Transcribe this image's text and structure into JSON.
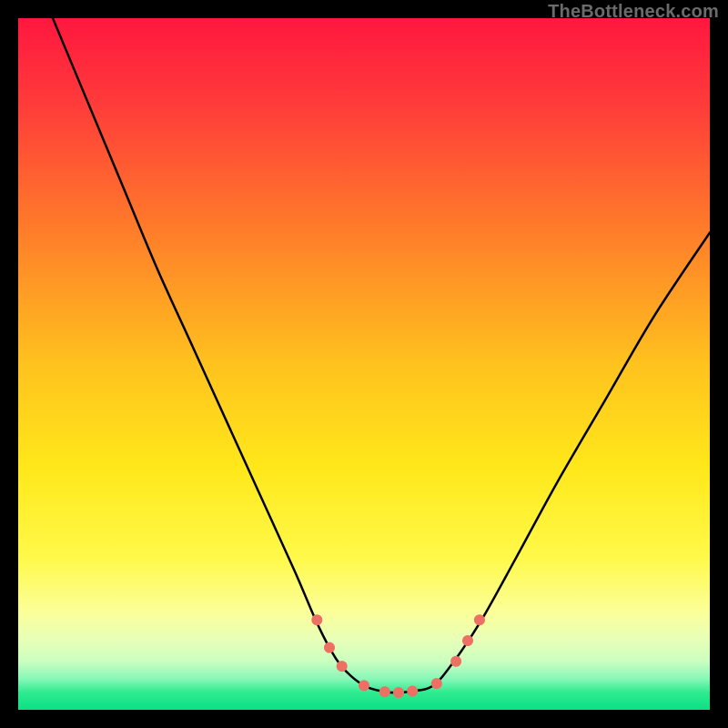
{
  "attribution": "TheBottleneck.com",
  "colors": {
    "frame": "#000000",
    "curve": "#000000",
    "marker_fill": "#ec7063",
    "gradient_stops": [
      {
        "offset": 0.0,
        "color": "#ff173f"
      },
      {
        "offset": 0.12,
        "color": "#ff3a3a"
      },
      {
        "offset": 0.3,
        "color": "#ff7a2a"
      },
      {
        "offset": 0.5,
        "color": "#ffc21e"
      },
      {
        "offset": 0.65,
        "color": "#ffe81a"
      },
      {
        "offset": 0.78,
        "color": "#fff94a"
      },
      {
        "offset": 0.86,
        "color": "#fbff9a"
      },
      {
        "offset": 0.9,
        "color": "#e7ffb8"
      },
      {
        "offset": 0.93,
        "color": "#caffc0"
      },
      {
        "offset": 0.955,
        "color": "#88f7b8"
      },
      {
        "offset": 0.975,
        "color": "#2eeb8f"
      },
      {
        "offset": 1.0,
        "color": "#0ddf85"
      }
    ]
  },
  "chart_data": {
    "type": "line",
    "title": "",
    "xlabel": "",
    "ylabel": "",
    "xlim": [
      0,
      100
    ],
    "ylim": [
      0,
      100
    ],
    "grid": false,
    "series": [
      {
        "name": "bottleneck-curve",
        "x": [
          5,
          10,
          15,
          20,
          25,
          30,
          35,
          40,
          43,
          45,
          47,
          50,
          53,
          55,
          57,
          60,
          63,
          67,
          72,
          78,
          85,
          92,
          100
        ],
        "y": [
          100,
          88,
          76,
          64,
          53,
          42,
          31,
          20,
          13,
          9,
          6,
          3.5,
          2.6,
          2.5,
          2.7,
          3.5,
          7,
          13,
          22,
          33,
          45,
          57,
          69
        ]
      }
    ],
    "markers": {
      "name": "bottleneck-markers",
      "x": [
        43.2,
        45.0,
        46.8,
        50.0,
        53.0,
        55.0,
        57.0,
        60.5,
        63.3,
        65.0,
        66.7
      ],
      "y": [
        13.0,
        9.0,
        6.3,
        3.5,
        2.6,
        2.5,
        2.7,
        3.8,
        7.0,
        10.0,
        13.0
      ],
      "radius": 6
    }
  }
}
